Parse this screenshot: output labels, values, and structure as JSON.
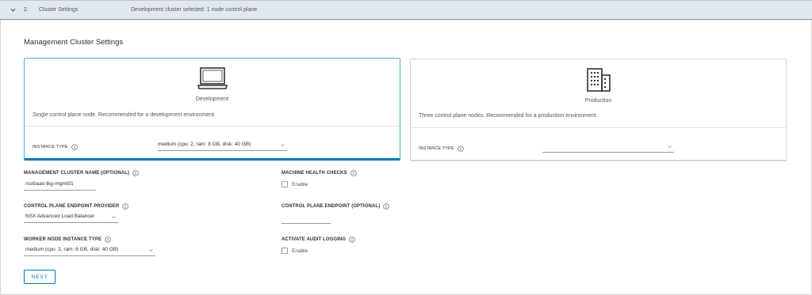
{
  "step": {
    "number": "2.",
    "title": "Cluster Settings",
    "summary": "Development cluster selected: 1 node control plane"
  },
  "section": {
    "title": "Management Cluster Settings"
  },
  "cards": {
    "development": {
      "name": "Development",
      "description": "Single control plane node. Recommended for a development environment.",
      "instance_type_label": "INSTANCE TYPE",
      "instance_type_value": "medium (cpu: 2, ram: 8 GB, disk: 40 GB)",
      "icon": "laptop-icon",
      "selected": true
    },
    "production": {
      "name": "Production",
      "description": "Three control plane nodes. Recommended for a production environment.",
      "instance_type_label": "INSTANCE TYPE",
      "instance_type_value": "",
      "icon": "building-icon",
      "selected": false
    }
  },
  "fields": {
    "cluster_name": {
      "label": "MANAGEMENT CLUSTER NAME (OPTIONAL)",
      "value": "nsxbaas-tkg-mgmt01"
    },
    "machine_health_checks": {
      "label": "MACHINE HEALTH CHECKS",
      "option": "Enable",
      "checked": false
    },
    "endpoint_provider": {
      "label": "CONTROL PLANE ENDPOINT PROVIDER",
      "value": "NSX Advanced Load Balancer"
    },
    "endpoint": {
      "label": "CONTROL PLANE ENDPOINT (OPTIONAL)",
      "value": ""
    },
    "worker_instance_type": {
      "label": "WORKER NODE INSTANCE TYPE",
      "value": "medium (cpu: 2, ram: 8 GB, disk: 40 GB)"
    },
    "audit_logging": {
      "label": "ACTIVATE AUDIT LOGGING",
      "option": "Enable",
      "checked": false
    }
  },
  "buttons": {
    "next": "NEXT"
  },
  "colors": {
    "accent": "#0079b8",
    "selected_border": "#49afd9",
    "header_bg": "#e1e8ee"
  }
}
